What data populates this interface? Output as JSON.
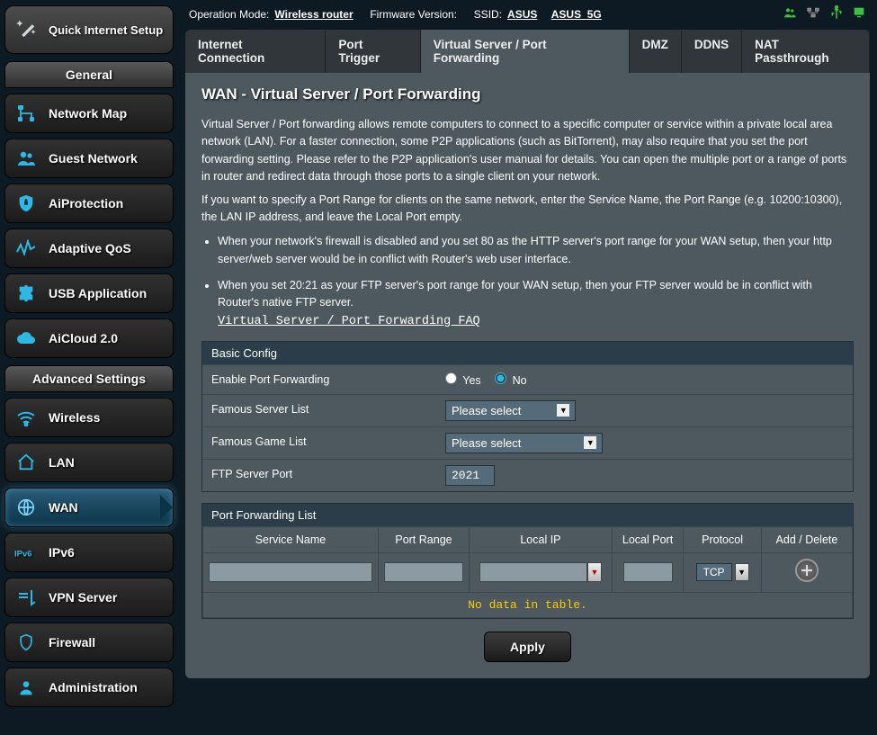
{
  "header": {
    "operation_mode_label": "Operation Mode:",
    "operation_mode_value": "Wireless router",
    "firmware_label": "Firmware Version:",
    "ssid_label": "SSID:",
    "ssid_1": "ASUS",
    "ssid_2": "ASUS_5G"
  },
  "qis_title": "Quick Internet Setup",
  "general_header": "General",
  "advanced_header": "Advanced Settings",
  "general_items": [
    {
      "label": "Network Map",
      "icon": "network-map-icon"
    },
    {
      "label": "Guest Network",
      "icon": "guest-network-icon"
    },
    {
      "label": "AiProtection",
      "icon": "shield-icon"
    },
    {
      "label": "Adaptive QoS",
      "icon": "qos-icon"
    },
    {
      "label": "USB Application",
      "icon": "puzzle-icon"
    },
    {
      "label": "AiCloud 2.0",
      "icon": "cloud-icon"
    }
  ],
  "advanced_items": [
    {
      "label": "Wireless",
      "icon": "wifi-icon"
    },
    {
      "label": "LAN",
      "icon": "home-icon"
    },
    {
      "label": "WAN",
      "icon": "globe-icon",
      "active": true
    },
    {
      "label": "IPv6",
      "icon": "ipv6-icon"
    },
    {
      "label": "VPN Server",
      "icon": "vpn-icon"
    },
    {
      "label": "Firewall",
      "icon": "firewall-icon"
    },
    {
      "label": "Administration",
      "icon": "admin-icon"
    }
  ],
  "tabs": [
    {
      "label": "Internet Connection"
    },
    {
      "label": "Port Trigger"
    },
    {
      "label": "Virtual Server / Port Forwarding",
      "active": true
    },
    {
      "label": "DMZ"
    },
    {
      "label": "DDNS"
    },
    {
      "label": "NAT Passthrough"
    }
  ],
  "page_title": "WAN - Virtual Server / Port Forwarding",
  "para1": "Virtual Server / Port forwarding allows remote computers to connect to a specific computer or service within a private local area network (LAN). For a faster connection, some P2P applications (such as BitTorrent), may also require that you set the port forwarding setting. Please refer to the P2P application's user manual for details. You can open the multiple port or a range of ports in router and redirect data through those ports to a single client on your network.",
  "para2": "If you want to specify a Port Range for clients on the same network, enter the Service Name, the Port Range (e.g. 10200:10300), the LAN IP address, and leave the Local Port empty.",
  "bullet1": "When your network's firewall is disabled and you set 80 as the HTTP server's port range for your WAN setup, then your http server/web server would be in conflict with Router's web user interface.",
  "bullet2": "When you set 20:21 as your FTP server's port range for your WAN setup, then your FTP server would be in conflict with Router's native FTP server.",
  "faq_link": "Virtual Server / Port Forwarding FAQ",
  "basic_config": {
    "header": "Basic Config",
    "enable_label": "Enable Port Forwarding",
    "yes": "Yes",
    "no": "No",
    "selected": "No",
    "server_list_label": "Famous Server List",
    "server_list_value": "Please select",
    "game_list_label": "Famous Game List",
    "game_list_value": "Please select",
    "ftp_port_label": "FTP Server Port",
    "ftp_port_value": "2021"
  },
  "port_list": {
    "header": "Port Forwarding List",
    "cols": {
      "service": "Service Name",
      "range": "Port Range",
      "ip": "Local IP",
      "port": "Local Port",
      "proto": "Protocol",
      "add": "Add / Delete"
    },
    "proto_value": "TCP",
    "nodata": "No data in table."
  },
  "apply_label": "Apply"
}
